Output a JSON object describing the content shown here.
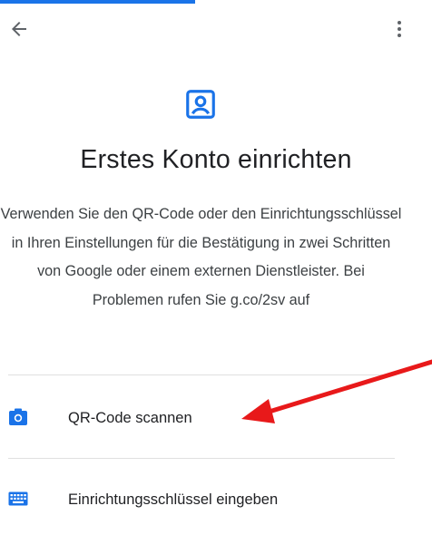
{
  "header": {
    "back_icon": "arrow-back-icon",
    "more_icon": "more-vert-icon"
  },
  "hero": {
    "icon": "account-box-icon",
    "title": "Erstes Konto einrichten",
    "description": "Verwenden Sie den QR-Code oder den Einrichtungsschlüssel in Ihren Einstellungen für die Bestätigung in zwei Schritten von Google oder einem externen Dienstleister. Bei Problemen rufen Sie g.co/2sv auf"
  },
  "options": [
    {
      "icon": "camera-icon",
      "label": "QR-Code scannen"
    },
    {
      "icon": "keyboard-icon",
      "label": "Einrichtungsschlüssel eingeben"
    }
  ],
  "annotation": {
    "type": "arrow",
    "color": "#e8191a",
    "target": "QR-Code scannen"
  },
  "colors": {
    "accent": "#1a73e8",
    "text_primary": "#202124",
    "text_secondary": "#3c4043",
    "divider": "#e0e0e0"
  }
}
